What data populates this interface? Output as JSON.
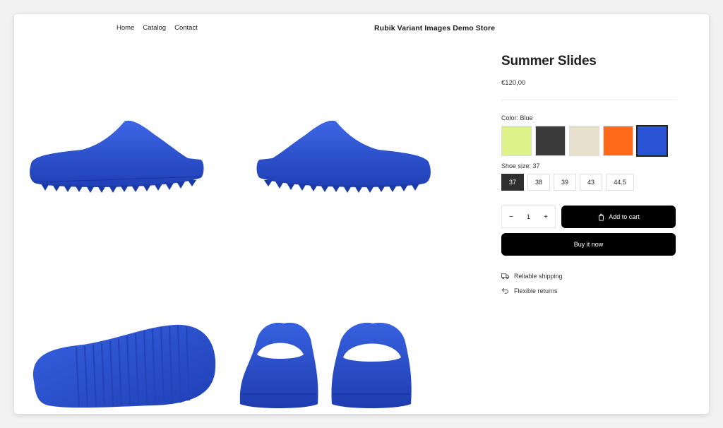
{
  "header": {
    "nav": [
      "Home",
      "Catalog",
      "Contact"
    ],
    "store_name": "Rubik Variant Images Demo Store"
  },
  "product": {
    "title": "Summer Slides",
    "price": "€120,00",
    "color_label": "Color: Blue",
    "colors": [
      {
        "name": "lime",
        "hex": "#dff28a"
      },
      {
        "name": "black",
        "hex": "#3a3a3a"
      },
      {
        "name": "cream",
        "hex": "#e6e0cc"
      },
      {
        "name": "orange",
        "hex": "#ff6a1a"
      },
      {
        "name": "blue",
        "hex": "#2a52d4",
        "selected": true
      }
    ],
    "size_label": "Shoe size: 37",
    "sizes": [
      "37",
      "38",
      "39",
      "43",
      "44.5"
    ],
    "selected_size": "37",
    "quantity": "1",
    "qty_minus": "−",
    "qty_plus": "+",
    "add_to_cart": "Add to cart",
    "buy_now": "Buy it now",
    "features": [
      "Reliable shipping",
      "Flexible returns"
    ]
  },
  "colors": {
    "product_blue": "#2a52d4",
    "button_bg": "#000000"
  },
  "icons": {
    "cart": "bag-icon",
    "shipping": "truck-icon",
    "returns": "return-arrow-icon"
  }
}
